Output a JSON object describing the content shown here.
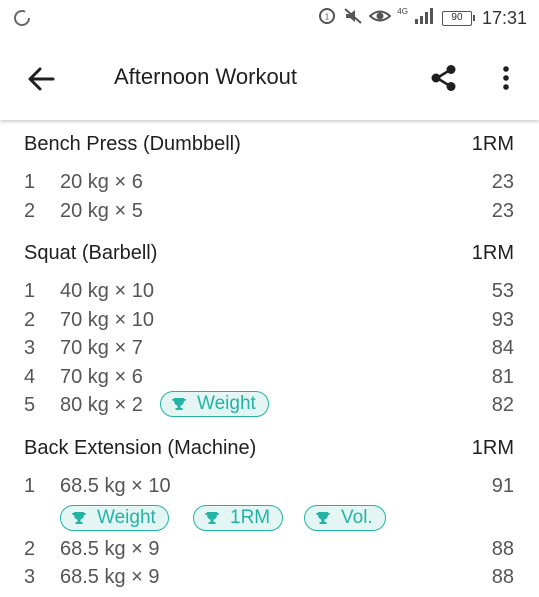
{
  "status": {
    "time": "17:31",
    "battery": "90",
    "network": "4G"
  },
  "toolbar": {
    "title": "Afternoon Workout"
  },
  "exercises": [
    {
      "name": "Bench Press (Dumbbell)",
      "metric": "1RM",
      "sets": [
        {
          "num": "1",
          "desc": "20 kg × 6",
          "value": "23"
        },
        {
          "num": "2",
          "desc": "20 kg × 5",
          "value": "23"
        }
      ]
    },
    {
      "name": "Squat (Barbell)",
      "metric": "1RM",
      "sets": [
        {
          "num": "1",
          "desc": "40 kg × 10",
          "value": "53"
        },
        {
          "num": "2",
          "desc": "70 kg × 10",
          "value": "93"
        },
        {
          "num": "3",
          "desc": "70 kg × 7",
          "value": "84"
        },
        {
          "num": "4",
          "desc": "70 kg × 6",
          "value": "81"
        },
        {
          "num": "5",
          "desc": "80 kg × 2",
          "value": "82",
          "badges": [
            "Weight"
          ]
        }
      ]
    },
    {
      "name": "Back Extension (Machine)",
      "metric": "1RM",
      "sets": [
        {
          "num": "1",
          "desc": "68.5 kg × 10",
          "value": "91",
          "badges": [
            "Weight",
            "1RM",
            "Vol."
          ]
        },
        {
          "num": "2",
          "desc": "68.5 kg × 9",
          "value": "88"
        },
        {
          "num": "3",
          "desc": "68.5 kg × 9",
          "value": "88"
        }
      ]
    }
  ],
  "colors": {
    "accent": "#25b3a6",
    "badge_bg": "#e3f6f3"
  },
  "icons": {
    "back": "arrow-left-icon",
    "share": "share-icon",
    "more": "more-vert-icon",
    "badge": "trophy-icon"
  }
}
